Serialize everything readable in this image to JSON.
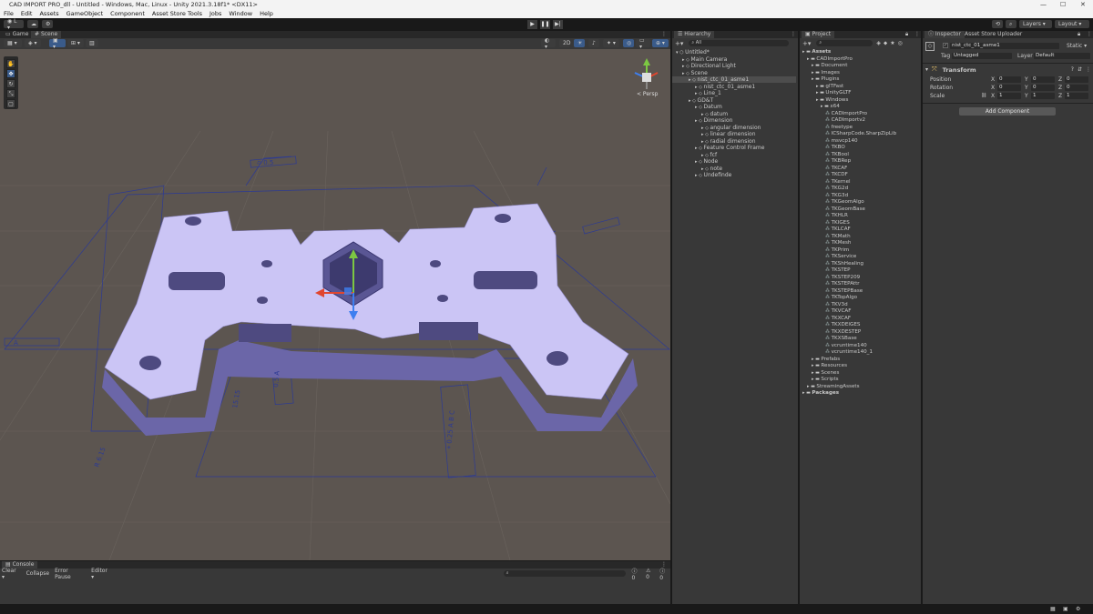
{
  "window": {
    "title": "CAD IMPORT PRO_dll - Untitled - Windows, Mac, Linux - Unity 2021.3.18f1* <DX11>"
  },
  "menu": [
    "File",
    "Edit",
    "Assets",
    "GameObject",
    "Component",
    "Asset Store Tools",
    "Jobs",
    "Window",
    "Help"
  ],
  "toolbar": {
    "layers": "Layers",
    "layout": "Layout"
  },
  "scene_tabs": {
    "game": "Game",
    "scene": "Scene"
  },
  "gizmo": {
    "persp": "< Persp"
  },
  "hierarchy": {
    "tab": "Hierarchy",
    "items": [
      {
        "label": "Untitled*",
        "indent": 0,
        "icon": "unity-scene-icon"
      },
      {
        "label": "Main Camera",
        "indent": 1,
        "icon": "gameobject-icon"
      },
      {
        "label": "Directional Light",
        "indent": 1,
        "icon": "gameobject-icon"
      },
      {
        "label": "Scene",
        "indent": 1,
        "icon": "gameobject-icon"
      },
      {
        "label": "nist_ctc_01_asme1",
        "indent": 2,
        "icon": "gameobject-icon"
      },
      {
        "label": "nist_ctc_01_asme1",
        "indent": 3,
        "icon": "gameobject-icon"
      },
      {
        "label": "Line_1",
        "indent": 3,
        "icon": "gameobject-icon"
      },
      {
        "label": "GD&T",
        "indent": 2,
        "icon": "gameobject-icon"
      },
      {
        "label": "Datum",
        "indent": 3,
        "icon": "gameobject-icon"
      },
      {
        "label": "datum",
        "indent": 4,
        "icon": "gameobject-icon"
      },
      {
        "label": "Dimension",
        "indent": 3,
        "icon": "gameobject-icon"
      },
      {
        "label": "angular dimension",
        "indent": 4,
        "icon": "gameobject-icon"
      },
      {
        "label": "linear dimension",
        "indent": 4,
        "icon": "gameobject-icon"
      },
      {
        "label": "radial dimension",
        "indent": 4,
        "icon": "gameobject-icon"
      },
      {
        "label": "Feature Control Frame",
        "indent": 3,
        "icon": "gameobject-icon"
      },
      {
        "label": "fcf",
        "indent": 4,
        "icon": "gameobject-icon"
      },
      {
        "label": "Node",
        "indent": 3,
        "icon": "gameobject-icon"
      },
      {
        "label": "note",
        "indent": 4,
        "icon": "gameobject-icon"
      },
      {
        "label": "Undefinde",
        "indent": 3,
        "icon": "gameobject-icon"
      }
    ]
  },
  "project": {
    "tab": "Project",
    "items": [
      {
        "label": "Assets",
        "indent": 0,
        "type": "folder"
      },
      {
        "label": "CADImportPro",
        "indent": 1,
        "type": "folder"
      },
      {
        "label": "Document",
        "indent": 2,
        "type": "folder"
      },
      {
        "label": "Images",
        "indent": 2,
        "type": "folder"
      },
      {
        "label": "Plugins",
        "indent": 2,
        "type": "folder"
      },
      {
        "label": "glTFast",
        "indent": 3,
        "type": "folder"
      },
      {
        "label": "UnityGLTF",
        "indent": 3,
        "type": "folder"
      },
      {
        "label": "Windows",
        "indent": 3,
        "type": "folder"
      },
      {
        "label": "x64",
        "indent": 4,
        "type": "folder"
      },
      {
        "label": "CADImportPro",
        "indent": 5,
        "type": "file"
      },
      {
        "label": "CADImportv2",
        "indent": 5,
        "type": "file"
      },
      {
        "label": "freetype",
        "indent": 5,
        "type": "file"
      },
      {
        "label": "ICSharpCode.SharpZipLib",
        "indent": 5,
        "type": "file"
      },
      {
        "label": "msvcp140",
        "indent": 5,
        "type": "file"
      },
      {
        "label": "TKBO",
        "indent": 5,
        "type": "file"
      },
      {
        "label": "TKBool",
        "indent": 5,
        "type": "file"
      },
      {
        "label": "TKBRep",
        "indent": 5,
        "type": "file"
      },
      {
        "label": "TKCAF",
        "indent": 5,
        "type": "file"
      },
      {
        "label": "TKCDF",
        "indent": 5,
        "type": "file"
      },
      {
        "label": "TKernel",
        "indent": 5,
        "type": "file"
      },
      {
        "label": "TKG2d",
        "indent": 5,
        "type": "file"
      },
      {
        "label": "TKG3d",
        "indent": 5,
        "type": "file"
      },
      {
        "label": "TKGeomAlgo",
        "indent": 5,
        "type": "file"
      },
      {
        "label": "TKGeomBase",
        "indent": 5,
        "type": "file"
      },
      {
        "label": "TKHLR",
        "indent": 5,
        "type": "file"
      },
      {
        "label": "TKIGES",
        "indent": 5,
        "type": "file"
      },
      {
        "label": "TKLCAF",
        "indent": 5,
        "type": "file"
      },
      {
        "label": "TKMath",
        "indent": 5,
        "type": "file"
      },
      {
        "label": "TKMesh",
        "indent": 5,
        "type": "file"
      },
      {
        "label": "TKPrim",
        "indent": 5,
        "type": "file"
      },
      {
        "label": "TKService",
        "indent": 5,
        "type": "file"
      },
      {
        "label": "TKShHealing",
        "indent": 5,
        "type": "file"
      },
      {
        "label": "TKSTEP",
        "indent": 5,
        "type": "file"
      },
      {
        "label": "TKSTEP209",
        "indent": 5,
        "type": "file"
      },
      {
        "label": "TKSTEPAttr",
        "indent": 5,
        "type": "file"
      },
      {
        "label": "TKSTEPBase",
        "indent": 5,
        "type": "file"
      },
      {
        "label": "TKTopAlgo",
        "indent": 5,
        "type": "file"
      },
      {
        "label": "TKV3d",
        "indent": 5,
        "type": "file"
      },
      {
        "label": "TKVCAF",
        "indent": 5,
        "type": "file"
      },
      {
        "label": "TKXCAF",
        "indent": 5,
        "type": "file"
      },
      {
        "label": "TKXDEIGES",
        "indent": 5,
        "type": "file"
      },
      {
        "label": "TKXDESTEP",
        "indent": 5,
        "type": "file"
      },
      {
        "label": "TKXSBase",
        "indent": 5,
        "type": "file"
      },
      {
        "label": "vcruntime140",
        "indent": 5,
        "type": "file"
      },
      {
        "label": "vcruntime140_1",
        "indent": 5,
        "type": "file"
      },
      {
        "label": "Prefabs",
        "indent": 2,
        "type": "folder"
      },
      {
        "label": "Resources",
        "indent": 2,
        "type": "folder"
      },
      {
        "label": "Scenes",
        "indent": 2,
        "type": "folder"
      },
      {
        "label": "Scripts",
        "indent": 2,
        "type": "folder"
      },
      {
        "label": "StreamingAssets",
        "indent": 1,
        "type": "folder"
      },
      {
        "label": "Packages",
        "indent": 0,
        "type": "folder"
      }
    ]
  },
  "inspector": {
    "tab": "Inspector",
    "tab2": "Asset Store Uploader",
    "object_name": "nist_ctc_01_asme1",
    "static_label": "Static",
    "tag_label": "Tag",
    "tag_value": "Untagged",
    "layer_label": "Layer",
    "layer_value": "Default",
    "transform_title": "Transform",
    "position": {
      "label": "Position",
      "x": "0",
      "y": "0",
      "z": "0"
    },
    "rotation": {
      "label": "Rotation",
      "x": "0",
      "y": "0",
      "z": "0"
    },
    "scale": {
      "label": "Scale",
      "x": "1",
      "y": "1",
      "z": "1"
    },
    "add_component": "Add Component"
  },
  "console": {
    "tab": "Console",
    "clear": "Clear",
    "collapse": "Collapse",
    "error_pause": "Error Pause",
    "editor": "Editor",
    "count_log": "0",
    "count_warn": "0",
    "count_err": "0"
  },
  "scene_annotations": {
    "top_frame": "⌭ 0.5",
    "datum_left": "A",
    "dim_side": "0.5 A",
    "fcf_front": "⌖ 0.25 A B C",
    "dim_bottom": "15.15",
    "radial": "R 6.15"
  },
  "colors": {
    "part": "#cbc5f5",
    "part_shadow": "#6b66a8",
    "annotation": "#2c3a94",
    "scene_bg": "#5c5550"
  }
}
